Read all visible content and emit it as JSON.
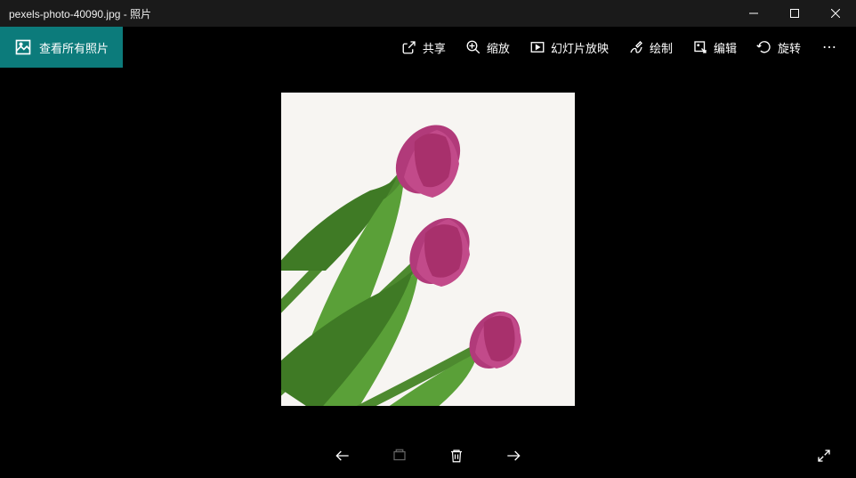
{
  "window": {
    "title": "pexels-photo-40090.jpg - 照片"
  },
  "toolbar": {
    "view_all": "查看所有照片",
    "share": "共享",
    "zoom": "缩放",
    "slideshow": "幻灯片放映",
    "draw": "绘制",
    "edit": "编辑",
    "rotate": "旋转"
  },
  "icons": {
    "minimize": "minimize-icon",
    "maximize": "maximize-icon",
    "close": "close-icon"
  }
}
